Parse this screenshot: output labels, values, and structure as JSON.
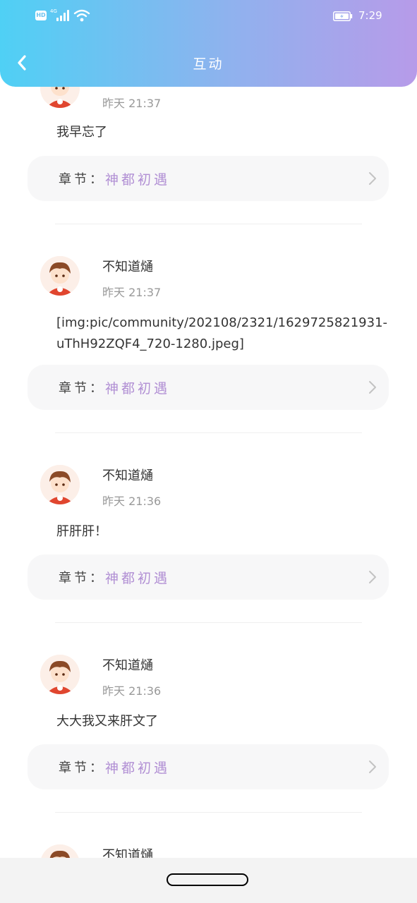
{
  "status_bar": {
    "hd": "HD",
    "network": "4G",
    "time": "7:29"
  },
  "header": {
    "title": "互动"
  },
  "colors": {
    "chapter_accent": "#b18fd4",
    "header_start": "#4fd0f5",
    "header_end": "#b79be9"
  },
  "comments": [
    {
      "username": "",
      "time": "昨天 21:37",
      "content": "我早忘了",
      "chapter_label": "章节：",
      "chapter": "神都初遇"
    },
    {
      "username": "不知道熥",
      "time": "昨天 21:37",
      "content": "[img:pic/community/202108/2321/1629725821931-uThH92ZQF4_720-1280.jpeg]",
      "chapter_label": "章节：",
      "chapter": "神都初遇"
    },
    {
      "username": "不知道熥",
      "time": "昨天 21:36",
      "content": "肝肝肝！",
      "chapter_label": "章节：",
      "chapter": "神都初遇"
    },
    {
      "username": "不知道熥",
      "time": "昨天 21:36",
      "content": "大大我又来肝文了",
      "chapter_label": "章节：",
      "chapter": "神都初遇"
    },
    {
      "username": "不知道熥"
    }
  ],
  "icons": {
    "back": "chevron-left-icon",
    "chapter_arrow": "chevron-right-icon",
    "avatar": "anime-avatar"
  }
}
